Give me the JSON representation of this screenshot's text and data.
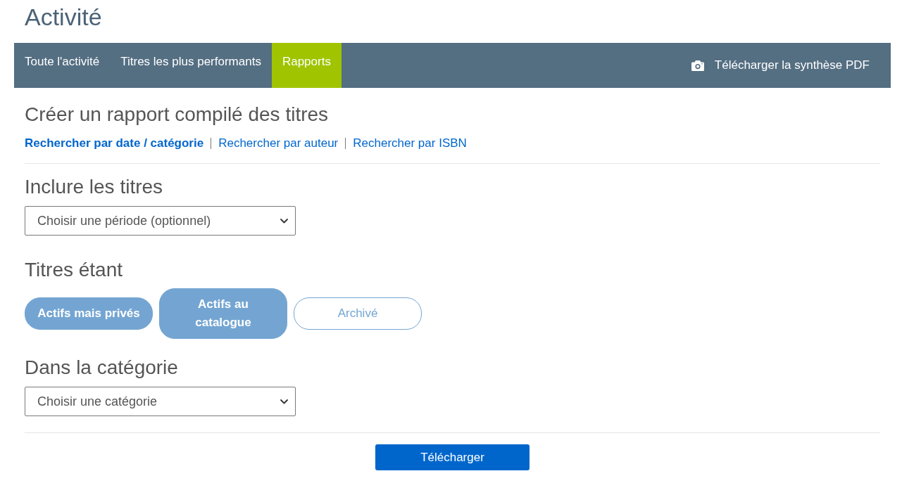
{
  "page_title": "Activité",
  "nav": {
    "tabs": [
      {
        "label": "Toute l'activité",
        "selected": false
      },
      {
        "label": "Titres les plus performants",
        "selected": false
      },
      {
        "label": "Rapports",
        "selected": true
      }
    ],
    "download_summary": {
      "label": "Télécharger la synthèse PDF"
    }
  },
  "report": {
    "title": "Créer un rapport compilé des titres",
    "search_modes": [
      {
        "label": "Rechercher par date / catégorie",
        "selected": true
      },
      {
        "label": "Rechercher par auteur",
        "selected": false
      },
      {
        "label": "Rechercher par ISBN",
        "selected": false
      }
    ]
  },
  "sections": [
    {
      "kind": "select",
      "heading": "Inclure les titres",
      "value": "Choisir une période (optionnel)"
    },
    {
      "kind": "toggles",
      "heading": "Titres étant",
      "options": [
        {
          "label": "Actifs mais privés",
          "selected": true
        },
        {
          "label": "Actifs au catalogue",
          "selected": true
        },
        {
          "label": "Archivé",
          "selected": false
        }
      ]
    },
    {
      "kind": "select",
      "heading": "Dans la catégorie",
      "value": "Choisir une catégorie"
    }
  ],
  "submit_button": {
    "label": "Télécharger"
  }
}
